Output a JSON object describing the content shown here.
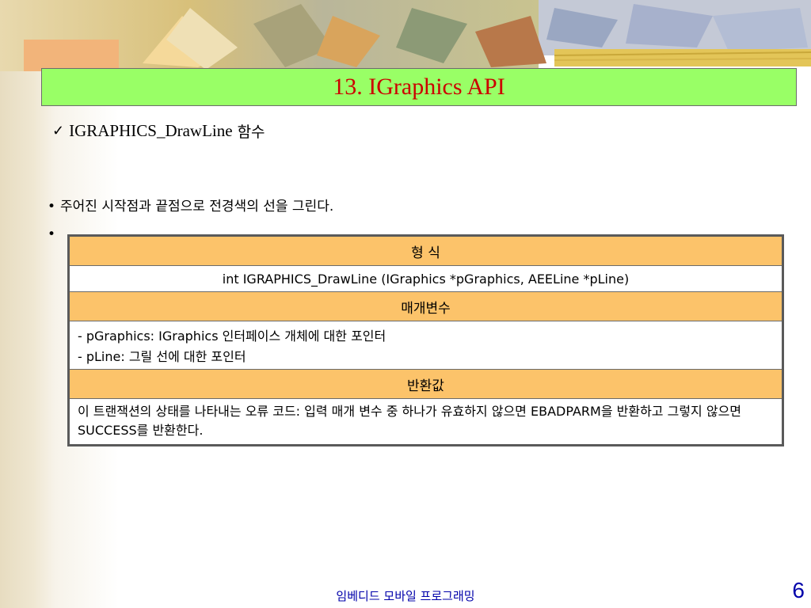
{
  "slide": {
    "title": "13. IGraphics API",
    "heading": "IGRAPHICS_DrawLine",
    "heading_suffix": "함수",
    "bullet1": "주어진 시작점과 끝점으로 전경색의 선을 그린다.",
    "bullet2": ""
  },
  "table": {
    "format_header": "형 식",
    "format_value": "int IGRAPHICS_DrawLine (IGraphics *pGraphics, AEELine *pLine)",
    "params_header": "매개변수",
    "param_lines": [
      "- pGraphics: IGraphics 인터페이스 개체에 대한 포인터",
      "- pLine: 그릴 선에 대한 포인터"
    ],
    "return_header": "반환값",
    "return_value": "이 트랜잭션의 상태를 나타내는 오류 코드: 입력 매개 변수 중 하나가 유효하지 않으면 EBADPARM을 반환하고 그렇지 않으면 SUCCESS를 반환한다."
  },
  "footer": {
    "course": "임베디드 모바일 프로그래밍",
    "page": "6"
  },
  "colors": {
    "title_bg": "#99ff66",
    "title_text": "#cc0000",
    "table_header_bg": "#fcc36a",
    "footer_text": "#0000aa"
  }
}
